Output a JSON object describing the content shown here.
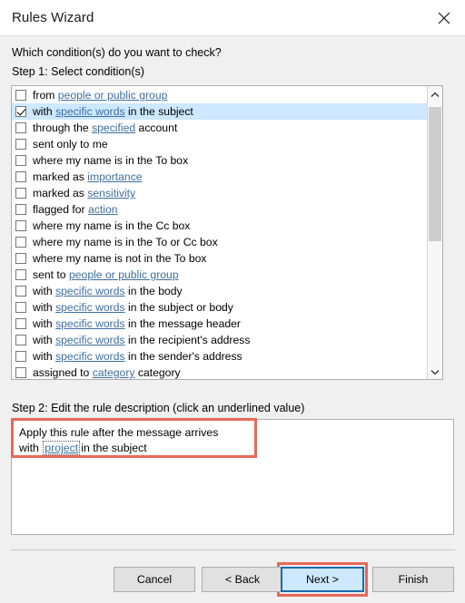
{
  "window": {
    "title": "Rules Wizard",
    "close_icon": "close-icon"
  },
  "main": {
    "prompt": "Which condition(s) do you want to check?",
    "step1_label": "Step 1: Select condition(s)",
    "step2_label": "Step 2: Edit the rule description (click an underlined value)"
  },
  "conditions": [
    {
      "checked": false,
      "parts": [
        {
          "t": "from ",
          "link": false
        },
        {
          "t": "people or public group",
          "link": true
        }
      ]
    },
    {
      "checked": true,
      "parts": [
        {
          "t": "with ",
          "link": false
        },
        {
          "t": "specific words",
          "link": true
        },
        {
          "t": " in the subject",
          "link": false
        }
      ]
    },
    {
      "checked": false,
      "parts": [
        {
          "t": "through the ",
          "link": false
        },
        {
          "t": "specified",
          "link": true
        },
        {
          "t": " account",
          "link": false
        }
      ]
    },
    {
      "checked": false,
      "parts": [
        {
          "t": "sent only to me",
          "link": false
        }
      ]
    },
    {
      "checked": false,
      "parts": [
        {
          "t": "where my name is in the To box",
          "link": false
        }
      ]
    },
    {
      "checked": false,
      "parts": [
        {
          "t": "marked as ",
          "link": false
        },
        {
          "t": "importance",
          "link": true
        }
      ]
    },
    {
      "checked": false,
      "parts": [
        {
          "t": "marked as ",
          "link": false
        },
        {
          "t": "sensitivity",
          "link": true
        }
      ]
    },
    {
      "checked": false,
      "parts": [
        {
          "t": "flagged for ",
          "link": false
        },
        {
          "t": "action",
          "link": true
        }
      ]
    },
    {
      "checked": false,
      "parts": [
        {
          "t": "where my name is in the Cc box",
          "link": false
        }
      ]
    },
    {
      "checked": false,
      "parts": [
        {
          "t": "where my name is in the To or Cc box",
          "link": false
        }
      ]
    },
    {
      "checked": false,
      "parts": [
        {
          "t": "where my name is not in the To box",
          "link": false
        }
      ]
    },
    {
      "checked": false,
      "parts": [
        {
          "t": "sent to ",
          "link": false
        },
        {
          "t": "people or public group",
          "link": true
        }
      ]
    },
    {
      "checked": false,
      "parts": [
        {
          "t": "with ",
          "link": false
        },
        {
          "t": "specific words",
          "link": true
        },
        {
          "t": " in the body",
          "link": false
        }
      ]
    },
    {
      "checked": false,
      "parts": [
        {
          "t": "with ",
          "link": false
        },
        {
          "t": "specific words",
          "link": true
        },
        {
          "t": " in the subject or body",
          "link": false
        }
      ]
    },
    {
      "checked": false,
      "parts": [
        {
          "t": "with ",
          "link": false
        },
        {
          "t": "specific words",
          "link": true
        },
        {
          "t": " in the message header",
          "link": false
        }
      ]
    },
    {
      "checked": false,
      "parts": [
        {
          "t": "with ",
          "link": false
        },
        {
          "t": "specific words",
          "link": true
        },
        {
          "t": " in the recipient's address",
          "link": false
        }
      ]
    },
    {
      "checked": false,
      "parts": [
        {
          "t": "with ",
          "link": false
        },
        {
          "t": "specific words",
          "link": true
        },
        {
          "t": " in the sender's address",
          "link": false
        }
      ]
    },
    {
      "checked": false,
      "parts": [
        {
          "t": "assigned to ",
          "link": false
        },
        {
          "t": "category",
          "link": true
        },
        {
          "t": " category",
          "link": false
        }
      ]
    }
  ],
  "scrollbar": {
    "up_icon": "chevron-up-icon",
    "down_icon": "chevron-down-icon"
  },
  "description": {
    "line1": "Apply this rule after the message arrives",
    "line2_prefix": "with ",
    "line2_value": "project",
    "line2_suffix": "in the subject"
  },
  "footer": {
    "cancel": "Cancel",
    "back": "< Back",
    "next": "Next >",
    "finish": "Finish"
  },
  "colors": {
    "selection": "#cde8ff",
    "link": "#3f6f9f",
    "annotation": "#e8685a",
    "focus": "#1a6bab",
    "dialog_bg": "#f0f0f0"
  }
}
